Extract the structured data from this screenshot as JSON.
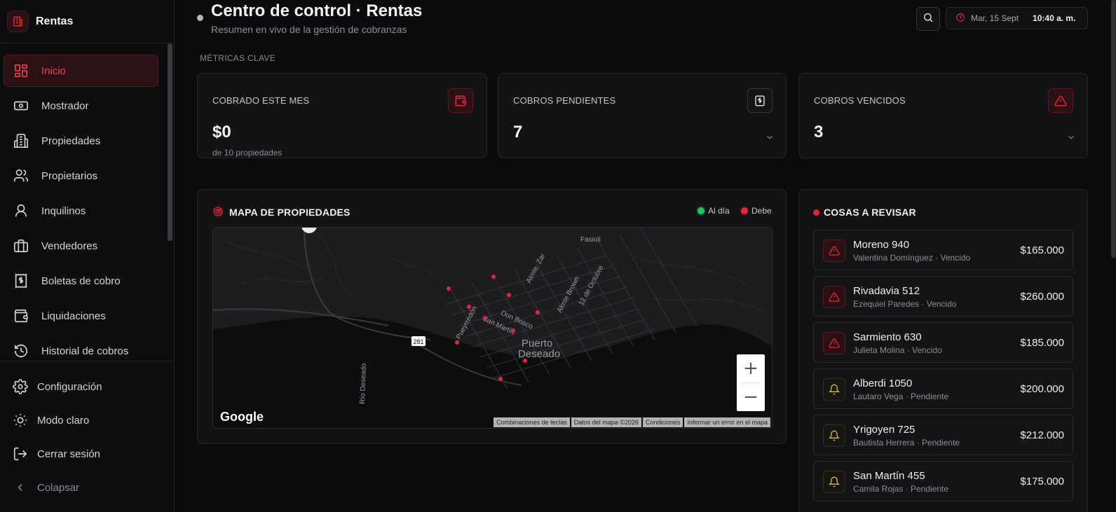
{
  "brand": {
    "name": "Rentas"
  },
  "sidebar": {
    "items": [
      {
        "label": "Inicio",
        "icon": "dashboard-icon",
        "active": true
      },
      {
        "label": "Mostrador",
        "icon": "cash-icon"
      },
      {
        "label": "Propiedades",
        "icon": "building-icon"
      },
      {
        "label": "Propietarios",
        "icon": "users-icon"
      },
      {
        "label": "Inquilinos",
        "icon": "user-icon"
      },
      {
        "label": "Vendedores",
        "icon": "briefcase-icon"
      },
      {
        "label": "Boletas de cobro",
        "icon": "receipt-icon"
      },
      {
        "label": "Liquidaciones",
        "icon": "wallet-icon"
      },
      {
        "label": "Historial de cobros",
        "icon": "history-icon"
      }
    ],
    "bottom": [
      {
        "label": "Configuración",
        "icon": "gear-icon"
      },
      {
        "label": "Modo claro",
        "icon": "sun-icon"
      },
      {
        "label": "Cerrar sesión",
        "icon": "logout-icon"
      },
      {
        "label": "Colapsar",
        "icon": "chevron-left-icon"
      }
    ]
  },
  "header": {
    "title": "Centro de control · Rentas",
    "subtitle": "Resumen en vivo de la gestión de cobranzas",
    "date": "Mar, 15 Sept",
    "time": "10:40 a. m."
  },
  "metrics": {
    "section_label": "MÉTRICAS CLAVE",
    "cards": [
      {
        "label": "COBRADO ESTE MES",
        "value": "$0",
        "sub": "de 10 propiedades",
        "icon": "wallet-icon"
      },
      {
        "label": "COBROS PENDIENTES",
        "value": "7",
        "icon": "dollar-doc-icon"
      },
      {
        "label": "COBROS VENCIDOS",
        "value": "3",
        "icon": "alert-icon"
      }
    ]
  },
  "map": {
    "title": "MAPA DE PROPIEDADES",
    "legend": [
      {
        "label": "Al día",
        "color": "#22c55e"
      },
      {
        "label": "Debe",
        "color": "#e3263b"
      }
    ],
    "labels": {
      "city_line1": "Puerto",
      "city_line2": "Deseado",
      "river": "Río Deseado",
      "street_zar": "Almte. Zar",
      "street_brown": "Almte Brown",
      "street_octubre": "12 de Octubre",
      "street_pueyrredon": "Pueyrredón",
      "street_bosco": "Don Bosco",
      "street_martin": "San Martín",
      "poi": "Fasioli",
      "route": "281"
    },
    "attribution": [
      "Combinaciones de teclas",
      "Datos del mapa ©2026",
      "Condiciones",
      "Informar un error en el mapa"
    ],
    "logo": "Google",
    "zoom_in": "+",
    "zoom_out": "−"
  },
  "review": {
    "title": "COSAS A REVISAR",
    "items": [
      {
        "name": "Moreno 940",
        "sub": "Valentina Domínguez · Vencido",
        "amount": "$165.000",
        "status": "danger"
      },
      {
        "name": "Rivadavia 512",
        "sub": "Ezequiel Paredes · Vencido",
        "amount": "$260.000",
        "status": "danger"
      },
      {
        "name": "Sarmiento 630",
        "sub": "Julieta Molina · Vencido",
        "amount": "$185.000",
        "status": "danger"
      },
      {
        "name": "Alberdi 1050",
        "sub": "Lautaro Vega · Pendiente",
        "amount": "$200.000",
        "status": "warn"
      },
      {
        "name": "Yrigoyen 725",
        "sub": "Bautista Herrera · Pendiente",
        "amount": "$212.000",
        "status": "warn"
      },
      {
        "name": "San Martín 455",
        "sub": "Camila Rojas · Pendiente",
        "amount": "$175.000",
        "status": "warn"
      }
    ]
  },
  "colors": {
    "accent": "#e3263b",
    "warn": "#e5b93a",
    "ok": "#22c55e"
  }
}
